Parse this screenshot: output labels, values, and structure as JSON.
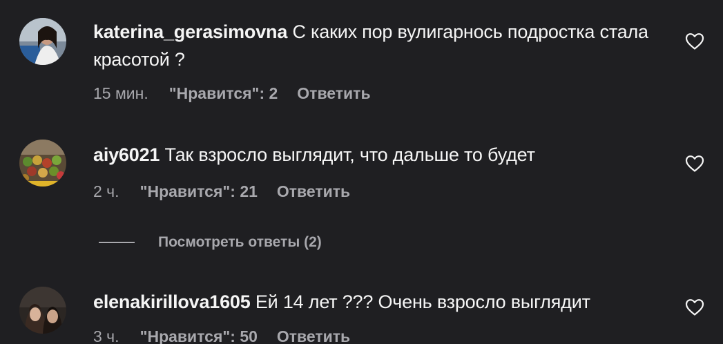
{
  "comments": [
    {
      "username": "katerina_gerasimovna",
      "text": " С каких пор вулигарнось подростка стала красотой ?",
      "time": "15 мин.",
      "likes": "\"Нравится\": 2",
      "reply": "Ответить"
    },
    {
      "username": "aiy6021",
      "text": " Так взросло выглядит, что дальше то будет",
      "time": "2 ч.",
      "likes": "\"Нравится\": 21",
      "reply": "Ответить"
    },
    {
      "username": "elenakirillova1605",
      "text": " Ей 14 лет ??? Очень взросло выглядит",
      "time": "3 ч.",
      "likes": "\"Нравится\": 50",
      "reply": "Ответить"
    }
  ],
  "view_replies": "Посмотреть ответы (2)",
  "icons": {
    "like": "heart-outline-icon"
  },
  "colors": {
    "background": "#1f1f22",
    "primary_text": "#f5f5f5",
    "secondary_text": "#a8a8ad"
  }
}
